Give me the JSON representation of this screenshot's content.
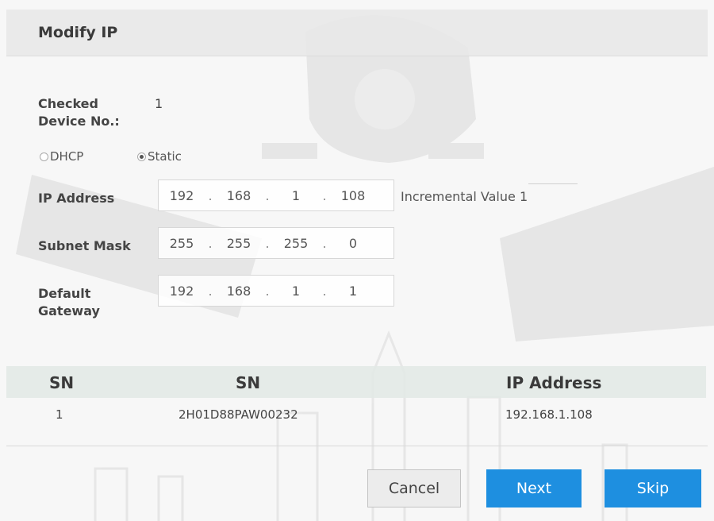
{
  "dialog": {
    "title": "Modify IP"
  },
  "checked": {
    "label_line1": "Checked",
    "label_line2": "Device No.:",
    "value": "1"
  },
  "mode": {
    "dhcp_label": "DHCP",
    "static_label": "Static",
    "selected": "Static"
  },
  "ip_address": {
    "label": "IP Address",
    "octets": [
      "192",
      "168",
      "1",
      "108"
    ]
  },
  "incremental": {
    "label": "Incremental Value",
    "value": "1"
  },
  "subnet_mask": {
    "label": "Subnet Mask",
    "octets": [
      "255",
      "255",
      "255",
      "0"
    ]
  },
  "gateway": {
    "label_line1": "Default",
    "label_line2": "Gateway",
    "octets": [
      "192",
      "168",
      "1",
      "1"
    ]
  },
  "table": {
    "headers": [
      "SN",
      "SN",
      "IP Address"
    ],
    "rows": [
      {
        "index": "1",
        "serial": "2H01D88PAW00232",
        "ip": "192.168.1.108"
      }
    ]
  },
  "buttons": {
    "cancel": "Cancel",
    "next": "Next",
    "skip": "Skip"
  },
  "colors": {
    "primary_button": "#1e8fe0",
    "title_bar": "#e8e8e8",
    "table_header": "#e2e9e5"
  }
}
